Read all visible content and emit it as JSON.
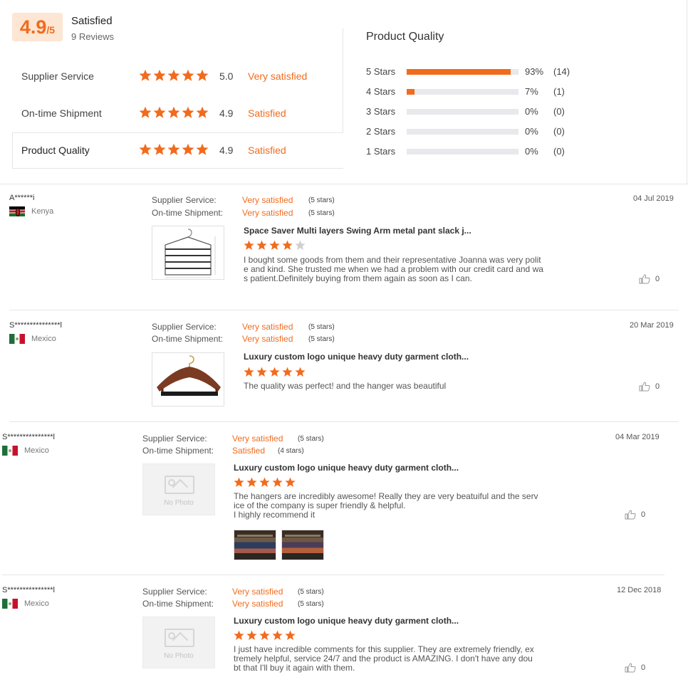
{
  "colors": {
    "accent": "#f26b1d",
    "star_empty": "#cfcfcf",
    "bar_track": "#e8e8ed"
  },
  "summary": {
    "score": "4.9",
    "score_max": "/5",
    "title": "Satisfied",
    "reviews": "9 Reviews",
    "metrics": [
      {
        "label": "Supplier Service",
        "stars": 5,
        "score": "5.0",
        "text": "Very satisfied"
      },
      {
        "label": "On-time Shipment",
        "stars": 5,
        "score": "4.9",
        "text": "Satisfied"
      },
      {
        "label": "Product Quality",
        "stars": 5,
        "score": "4.9",
        "text": "Satisfied"
      }
    ]
  },
  "product_quality": {
    "title": "Product Quality",
    "rows": [
      {
        "label": "5 Stars",
        "pct": "93%",
        "count": "(14)",
        "fraction": 0.93
      },
      {
        "label": "4 Stars",
        "pct": "7%",
        "count": "(1)",
        "fraction": 0.07
      },
      {
        "label": "3 Stars",
        "pct": "0%",
        "count": "(0)",
        "fraction": 0
      },
      {
        "label": "2 Stars",
        "pct": "0%",
        "count": "(0)",
        "fraction": 0
      },
      {
        "label": "1 Stars",
        "pct": "0%",
        "count": "(0)",
        "fraction": 0
      }
    ]
  },
  "review_labels": {
    "supplier": "Supplier Service:",
    "shipment": "On-time Shipment:",
    "no_photo": "No Photo"
  },
  "reviews": [
    {
      "user": "A******i",
      "country": "Kenya",
      "flag": "kenya-flag",
      "supplier_text": "Very satisfied",
      "supplier_stars": "(5 stars)",
      "shipment_text": "Very satisfied",
      "shipment_stars": "(5 stars)",
      "date": "04 Jul 2019",
      "product": "Space Saver Multi layers Swing Arm metal pant slack j...",
      "rating": 4,
      "text_lines": [
        "I bought some goods from them and their representative Joanna was very polit",
        "e and kind. She trusted me when we had a problem with our credit card and wa",
        "s patient.Definitely buying from them again as soon as I can."
      ],
      "likes": "0"
    },
    {
      "user": "S***************l",
      "country": "Mexico",
      "flag": "mexico-flag",
      "supplier_text": "Very satisfied",
      "supplier_stars": "(5 stars)",
      "shipment_text": "Very satisfied",
      "shipment_stars": "(5 stars)",
      "date": "20 Mar 2019",
      "product": "Luxury custom logo unique heavy duty garment cloth...",
      "rating": 5,
      "text_lines": [
        "The quality was perfect! and the hanger was beautiful"
      ],
      "likes": "0"
    },
    {
      "user": "S***************l",
      "country": "Mexico",
      "flag": "mexico-flag",
      "supplier_text": "Very satisfied",
      "supplier_stars": "(5 stars)",
      "shipment_text": "Satisfied",
      "shipment_stars": "(4 stars)",
      "date": "04 Mar 2019",
      "product": "Luxury custom logo unique heavy duty garment cloth...",
      "rating": 5,
      "text_lines": [
        "The hangers are incredibly awesome! Really they are very beatuiful and the serv",
        "ice of the company is super friendly & helpful.",
        "I highly recommend it"
      ],
      "likes": "0"
    },
    {
      "user": "S***************l",
      "country": "Mexico",
      "flag": "mexico-flag",
      "supplier_text": "Very satisfied",
      "supplier_stars": "(5 stars)",
      "shipment_text": "Very satisfied",
      "shipment_stars": "(5 stars)",
      "date": "12 Dec 2018",
      "product": "Luxury custom logo unique heavy duty garment cloth...",
      "rating": 5,
      "text_lines": [
        "I just have incredible comments for this supplier. They are extremely friendly, ex",
        "tremely helpful, service 24/7 and the product is AMAZING. I don't have any dou",
        "bt that I'll buy it again with them."
      ],
      "likes": "0"
    }
  ]
}
